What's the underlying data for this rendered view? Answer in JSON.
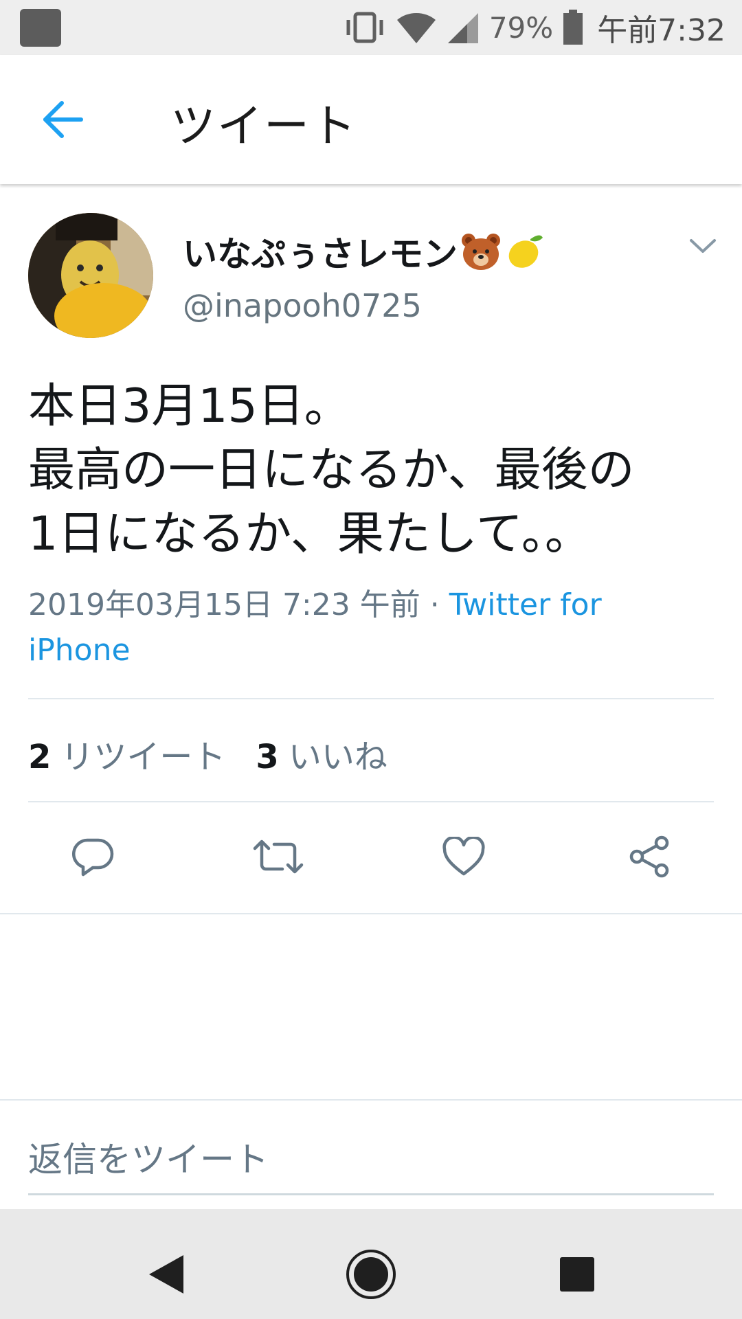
{
  "status_bar": {
    "battery_percent": "79%",
    "time": "午前7:32",
    "icons": [
      "app-icon",
      "vibrate-icon",
      "wifi-icon",
      "signal-icon",
      "battery-icon"
    ]
  },
  "header": {
    "title": "ツイート",
    "back_icon": "arrow-left-icon"
  },
  "tweet": {
    "display_name": "いなぷぅさレモン",
    "name_emojis": [
      "bear-face-icon",
      "lemon-icon"
    ],
    "handle": "@inapooh0725",
    "text": "本日3月15日。\n最高の一日になるか、最後の\n1日になるか、果たして。。",
    "timestamp": "2019年03月15日 7:23 午前",
    "separator": " · ",
    "source": "Twitter for iPhone",
    "retweet_count": "2",
    "retweet_label": "リツイート",
    "like_count": "3",
    "like_label": "いいね"
  },
  "actions": [
    "reply-icon",
    "retweet-icon",
    "like-icon",
    "share-icon"
  ],
  "reply_box": {
    "placeholder": "返信をツイート"
  },
  "colors": {
    "accent": "#1da1f2",
    "text_primary": "#14171a",
    "text_secondary": "#657786",
    "divider": "#e1e8ed"
  }
}
